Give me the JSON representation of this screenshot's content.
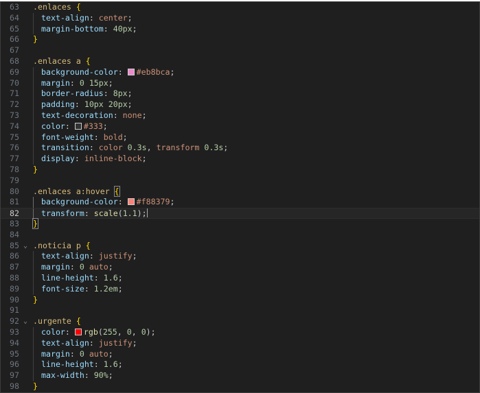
{
  "editor": {
    "current_line": 82,
    "lines": [
      {
        "n": "63",
        "segs": [
          {
            "t": ".enlaces ",
            "c": "sel"
          },
          {
            "t": "{",
            "c": "brace"
          }
        ]
      },
      {
        "n": "64",
        "guide": true,
        "segs": [
          {
            "t": "text-align",
            "c": "prop"
          },
          {
            "t": ": ",
            "c": "punct"
          },
          {
            "t": "center",
            "c": "val"
          },
          {
            "t": ";",
            "c": "punct"
          }
        ]
      },
      {
        "n": "65",
        "guide": true,
        "segs": [
          {
            "t": "margin-bottom",
            "c": "prop"
          },
          {
            "t": ": ",
            "c": "punct"
          },
          {
            "t": "40px",
            "c": "num"
          },
          {
            "t": ";",
            "c": "punct"
          }
        ]
      },
      {
        "n": "66",
        "segs": [
          {
            "t": "}",
            "c": "brace"
          }
        ]
      },
      {
        "n": "67",
        "segs": []
      },
      {
        "n": "68",
        "segs": [
          {
            "t": ".enlaces a ",
            "c": "sel"
          },
          {
            "t": "{",
            "c": "brace"
          }
        ]
      },
      {
        "n": "69",
        "guide": true,
        "segs": [
          {
            "t": "background-color",
            "c": "prop"
          },
          {
            "t": ": ",
            "c": "punct"
          },
          {
            "swatch": "#eb8bca"
          },
          {
            "t": "#eb8bca",
            "c": "val"
          },
          {
            "t": ";",
            "c": "punct"
          }
        ]
      },
      {
        "n": "70",
        "guide": true,
        "segs": [
          {
            "t": "margin",
            "c": "prop"
          },
          {
            "t": ": ",
            "c": "punct"
          },
          {
            "t": "0",
            "c": "num"
          },
          {
            "t": " ",
            "c": "punct"
          },
          {
            "t": "15px",
            "c": "num"
          },
          {
            "t": ";",
            "c": "punct"
          }
        ]
      },
      {
        "n": "71",
        "guide": true,
        "segs": [
          {
            "t": "border-radius",
            "c": "prop"
          },
          {
            "t": ": ",
            "c": "punct"
          },
          {
            "t": "8px",
            "c": "num"
          },
          {
            "t": ";",
            "c": "punct"
          }
        ]
      },
      {
        "n": "72",
        "guide": true,
        "segs": [
          {
            "t": "padding",
            "c": "prop"
          },
          {
            "t": ": ",
            "c": "punct"
          },
          {
            "t": "10px",
            "c": "num"
          },
          {
            "t": " ",
            "c": "punct"
          },
          {
            "t": "20px",
            "c": "num"
          },
          {
            "t": ";",
            "c": "punct"
          }
        ]
      },
      {
        "n": "73",
        "guide": true,
        "segs": [
          {
            "t": "text-decoration",
            "c": "prop"
          },
          {
            "t": ": ",
            "c": "punct"
          },
          {
            "t": "none",
            "c": "val"
          },
          {
            "t": ";",
            "c": "punct"
          }
        ]
      },
      {
        "n": "74",
        "guide": true,
        "segs": [
          {
            "t": "color",
            "c": "prop"
          },
          {
            "t": ": ",
            "c": "punct"
          },
          {
            "swatch": "#333333"
          },
          {
            "t": "#333",
            "c": "val"
          },
          {
            "t": ";",
            "c": "punct"
          }
        ]
      },
      {
        "n": "75",
        "guide": true,
        "segs": [
          {
            "t": "font-weight",
            "c": "prop"
          },
          {
            "t": ": ",
            "c": "punct"
          },
          {
            "t": "bold",
            "c": "val"
          },
          {
            "t": ";",
            "c": "punct"
          }
        ]
      },
      {
        "n": "76",
        "guide": true,
        "segs": [
          {
            "t": "transition",
            "c": "prop"
          },
          {
            "t": ": ",
            "c": "punct"
          },
          {
            "t": "color ",
            "c": "val"
          },
          {
            "t": "0.3s",
            "c": "num"
          },
          {
            "t": ", ",
            "c": "punct"
          },
          {
            "t": "transform ",
            "c": "val"
          },
          {
            "t": "0.3s",
            "c": "num"
          },
          {
            "t": ";",
            "c": "punct"
          }
        ]
      },
      {
        "n": "77",
        "guide": true,
        "segs": [
          {
            "t": "display",
            "c": "prop"
          },
          {
            "t": ": ",
            "c": "punct"
          },
          {
            "t": "inline-block",
            "c": "val"
          },
          {
            "t": ";",
            "c": "punct"
          }
        ]
      },
      {
        "n": "78",
        "segs": [
          {
            "t": "}",
            "c": "brace"
          }
        ]
      },
      {
        "n": "79",
        "segs": []
      },
      {
        "n": "80",
        "segs": [
          {
            "t": ".enlaces a:hover ",
            "c": "sel"
          },
          {
            "t": "{",
            "c": "brace match"
          }
        ]
      },
      {
        "n": "81",
        "guide": true,
        "active": true,
        "segs": [
          {
            "t": "background-color",
            "c": "prop"
          },
          {
            "t": ": ",
            "c": "punct"
          },
          {
            "swatch": "#f88379"
          },
          {
            "t": "#f88379",
            "c": "val"
          },
          {
            "t": ";",
            "c": "punct"
          }
        ]
      },
      {
        "n": "82",
        "guide": true,
        "active": true,
        "current": true,
        "cursor": true,
        "segs": [
          {
            "t": "transform",
            "c": "prop"
          },
          {
            "t": ": ",
            "c": "punct"
          },
          {
            "t": "scale",
            "c": "fn"
          },
          {
            "t": "(",
            "c": "punct"
          },
          {
            "t": "1.1",
            "c": "num"
          },
          {
            "t": ");",
            "c": "punct"
          }
        ]
      },
      {
        "n": "83",
        "segs": [
          {
            "t": "}",
            "c": "brace match"
          }
        ]
      },
      {
        "n": "84",
        "segs": []
      },
      {
        "n": "85",
        "fold": true,
        "segs": [
          {
            "t": ".noticia p ",
            "c": "sel"
          },
          {
            "t": "{",
            "c": "brace"
          }
        ]
      },
      {
        "n": "86",
        "guide": true,
        "segs": [
          {
            "t": "text-align",
            "c": "prop"
          },
          {
            "t": ": ",
            "c": "punct"
          },
          {
            "t": "justify",
            "c": "val"
          },
          {
            "t": ";",
            "c": "punct"
          }
        ]
      },
      {
        "n": "87",
        "guide": true,
        "segs": [
          {
            "t": "margin",
            "c": "prop"
          },
          {
            "t": ": ",
            "c": "punct"
          },
          {
            "t": "0",
            "c": "num"
          },
          {
            "t": " ",
            "c": "punct"
          },
          {
            "t": "auto",
            "c": "val"
          },
          {
            "t": ";",
            "c": "punct"
          }
        ]
      },
      {
        "n": "88",
        "guide": true,
        "segs": [
          {
            "t": "line-height",
            "c": "prop"
          },
          {
            "t": ": ",
            "c": "punct"
          },
          {
            "t": "1.6",
            "c": "num"
          },
          {
            "t": ";",
            "c": "punct"
          }
        ]
      },
      {
        "n": "89",
        "guide": true,
        "segs": [
          {
            "t": "font-size",
            "c": "prop"
          },
          {
            "t": ": ",
            "c": "punct"
          },
          {
            "t": "1.2em",
            "c": "num"
          },
          {
            "t": ";",
            "c": "punct"
          }
        ]
      },
      {
        "n": "90",
        "segs": [
          {
            "t": "}",
            "c": "brace"
          }
        ]
      },
      {
        "n": "91",
        "segs": []
      },
      {
        "n": "92",
        "fold": true,
        "segs": [
          {
            "t": ".urgente ",
            "c": "sel"
          },
          {
            "t": "{",
            "c": "brace"
          }
        ]
      },
      {
        "n": "93",
        "guide": true,
        "segs": [
          {
            "t": "color",
            "c": "prop"
          },
          {
            "t": ": ",
            "c": "punct"
          },
          {
            "swatch": "#ff0000"
          },
          {
            "t": "rgb",
            "c": "fn"
          },
          {
            "t": "(",
            "c": "punct"
          },
          {
            "t": "255",
            "c": "num"
          },
          {
            "t": ", ",
            "c": "punct"
          },
          {
            "t": "0",
            "c": "num"
          },
          {
            "t": ", ",
            "c": "punct"
          },
          {
            "t": "0",
            "c": "num"
          },
          {
            "t": ");",
            "c": "punct"
          }
        ]
      },
      {
        "n": "94",
        "guide": true,
        "segs": [
          {
            "t": "text-align",
            "c": "prop"
          },
          {
            "t": ": ",
            "c": "punct"
          },
          {
            "t": "justify",
            "c": "val"
          },
          {
            "t": ";",
            "c": "punct"
          }
        ]
      },
      {
        "n": "95",
        "guide": true,
        "segs": [
          {
            "t": "margin",
            "c": "prop"
          },
          {
            "t": ": ",
            "c": "punct"
          },
          {
            "t": "0",
            "c": "num"
          },
          {
            "t": " ",
            "c": "punct"
          },
          {
            "t": "auto",
            "c": "val"
          },
          {
            "t": ";",
            "c": "punct"
          }
        ]
      },
      {
        "n": "96",
        "guide": true,
        "segs": [
          {
            "t": "line-height",
            "c": "prop"
          },
          {
            "t": ": ",
            "c": "punct"
          },
          {
            "t": "1.6",
            "c": "num"
          },
          {
            "t": ";",
            "c": "punct"
          }
        ]
      },
      {
        "n": "97",
        "guide": true,
        "segs": [
          {
            "t": "max-width",
            "c": "prop"
          },
          {
            "t": ": ",
            "c": "punct"
          },
          {
            "t": "90%",
            "c": "num"
          },
          {
            "t": ";",
            "c": "punct"
          }
        ]
      },
      {
        "n": "98",
        "segs": [
          {
            "t": "}",
            "c": "brace"
          }
        ]
      }
    ]
  }
}
